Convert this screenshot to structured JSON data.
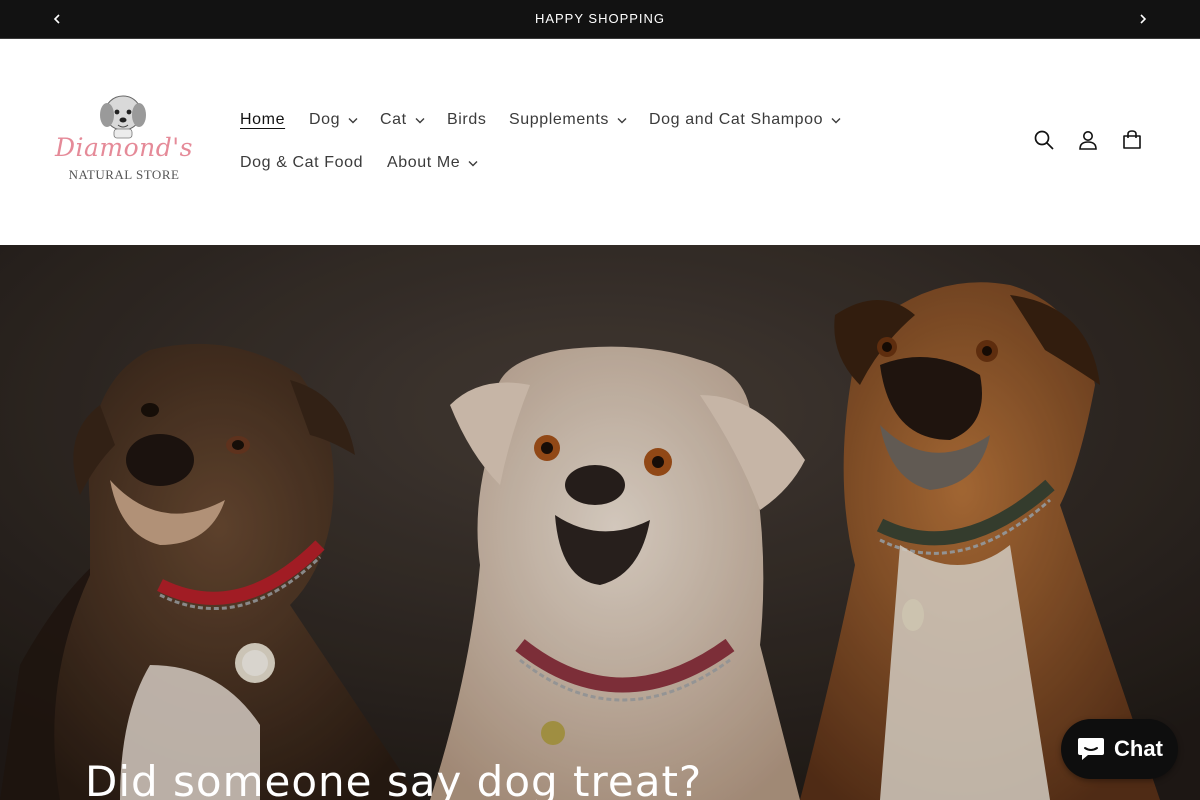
{
  "announcement": {
    "text": "HAPPY SHOPPING",
    "prev_icon": "chevron-left-icon",
    "next_icon": "chevron-right-icon"
  },
  "logo": {
    "line1": "Diamond's",
    "line2": "NATURAL STORE"
  },
  "nav": {
    "home": "Home",
    "dog": "Dog",
    "cat": "Cat",
    "birds": "Birds",
    "supplements": "Supplements",
    "shampoo": "Dog and Cat Shampoo",
    "food": "Dog & Cat Food",
    "about": "About Me"
  },
  "header_icons": [
    "search-icon",
    "account-icon",
    "cart-icon"
  ],
  "hero": {
    "heading": "Did someone say dog treat?"
  },
  "chat": {
    "label": "Chat",
    "icon": "chat-bubble-icon"
  },
  "colors": {
    "announcement_bg": "#121212",
    "text": "#121212",
    "logo_pink": "#e58a98",
    "chat_bg": "#0e0e0e"
  }
}
